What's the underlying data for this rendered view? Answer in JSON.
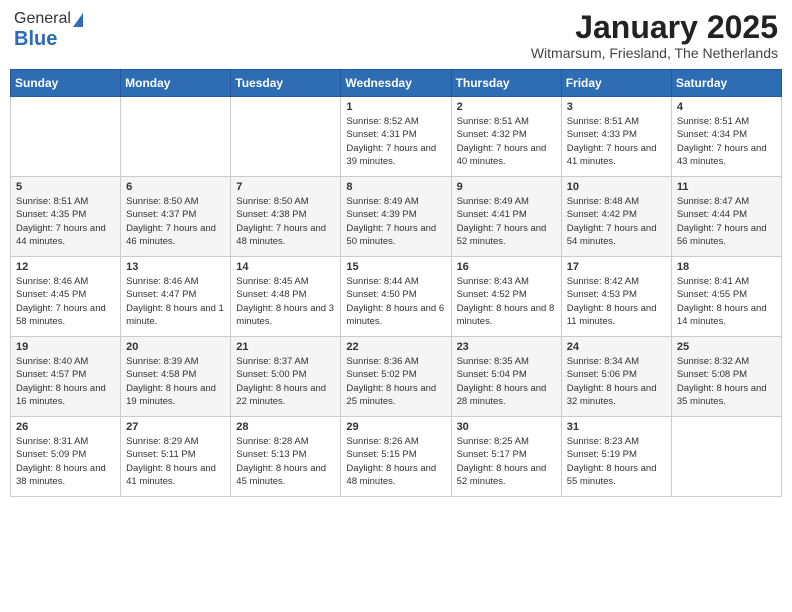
{
  "header": {
    "logo_general": "General",
    "logo_blue": "Blue",
    "month": "January 2025",
    "location": "Witmarsum, Friesland, The Netherlands"
  },
  "weekdays": [
    "Sunday",
    "Monday",
    "Tuesday",
    "Wednesday",
    "Thursday",
    "Friday",
    "Saturday"
  ],
  "weeks": [
    [
      {
        "day": "",
        "sunrise": "",
        "sunset": "",
        "daylight": ""
      },
      {
        "day": "",
        "sunrise": "",
        "sunset": "",
        "daylight": ""
      },
      {
        "day": "",
        "sunrise": "",
        "sunset": "",
        "daylight": ""
      },
      {
        "day": "1",
        "sunrise": "Sunrise: 8:52 AM",
        "sunset": "Sunset: 4:31 PM",
        "daylight": "Daylight: 7 hours and 39 minutes."
      },
      {
        "day": "2",
        "sunrise": "Sunrise: 8:51 AM",
        "sunset": "Sunset: 4:32 PM",
        "daylight": "Daylight: 7 hours and 40 minutes."
      },
      {
        "day": "3",
        "sunrise": "Sunrise: 8:51 AM",
        "sunset": "Sunset: 4:33 PM",
        "daylight": "Daylight: 7 hours and 41 minutes."
      },
      {
        "day": "4",
        "sunrise": "Sunrise: 8:51 AM",
        "sunset": "Sunset: 4:34 PM",
        "daylight": "Daylight: 7 hours and 43 minutes."
      }
    ],
    [
      {
        "day": "5",
        "sunrise": "Sunrise: 8:51 AM",
        "sunset": "Sunset: 4:35 PM",
        "daylight": "Daylight: 7 hours and 44 minutes."
      },
      {
        "day": "6",
        "sunrise": "Sunrise: 8:50 AM",
        "sunset": "Sunset: 4:37 PM",
        "daylight": "Daylight: 7 hours and 46 minutes."
      },
      {
        "day": "7",
        "sunrise": "Sunrise: 8:50 AM",
        "sunset": "Sunset: 4:38 PM",
        "daylight": "Daylight: 7 hours and 48 minutes."
      },
      {
        "day": "8",
        "sunrise": "Sunrise: 8:49 AM",
        "sunset": "Sunset: 4:39 PM",
        "daylight": "Daylight: 7 hours and 50 minutes."
      },
      {
        "day": "9",
        "sunrise": "Sunrise: 8:49 AM",
        "sunset": "Sunset: 4:41 PM",
        "daylight": "Daylight: 7 hours and 52 minutes."
      },
      {
        "day": "10",
        "sunrise": "Sunrise: 8:48 AM",
        "sunset": "Sunset: 4:42 PM",
        "daylight": "Daylight: 7 hours and 54 minutes."
      },
      {
        "day": "11",
        "sunrise": "Sunrise: 8:47 AM",
        "sunset": "Sunset: 4:44 PM",
        "daylight": "Daylight: 7 hours and 56 minutes."
      }
    ],
    [
      {
        "day": "12",
        "sunrise": "Sunrise: 8:46 AM",
        "sunset": "Sunset: 4:45 PM",
        "daylight": "Daylight: 7 hours and 58 minutes."
      },
      {
        "day": "13",
        "sunrise": "Sunrise: 8:46 AM",
        "sunset": "Sunset: 4:47 PM",
        "daylight": "Daylight: 8 hours and 1 minute."
      },
      {
        "day": "14",
        "sunrise": "Sunrise: 8:45 AM",
        "sunset": "Sunset: 4:48 PM",
        "daylight": "Daylight: 8 hours and 3 minutes."
      },
      {
        "day": "15",
        "sunrise": "Sunrise: 8:44 AM",
        "sunset": "Sunset: 4:50 PM",
        "daylight": "Daylight: 8 hours and 6 minutes."
      },
      {
        "day": "16",
        "sunrise": "Sunrise: 8:43 AM",
        "sunset": "Sunset: 4:52 PM",
        "daylight": "Daylight: 8 hours and 8 minutes."
      },
      {
        "day": "17",
        "sunrise": "Sunrise: 8:42 AM",
        "sunset": "Sunset: 4:53 PM",
        "daylight": "Daylight: 8 hours and 11 minutes."
      },
      {
        "day": "18",
        "sunrise": "Sunrise: 8:41 AM",
        "sunset": "Sunset: 4:55 PM",
        "daylight": "Daylight: 8 hours and 14 minutes."
      }
    ],
    [
      {
        "day": "19",
        "sunrise": "Sunrise: 8:40 AM",
        "sunset": "Sunset: 4:57 PM",
        "daylight": "Daylight: 8 hours and 16 minutes."
      },
      {
        "day": "20",
        "sunrise": "Sunrise: 8:39 AM",
        "sunset": "Sunset: 4:58 PM",
        "daylight": "Daylight: 8 hours and 19 minutes."
      },
      {
        "day": "21",
        "sunrise": "Sunrise: 8:37 AM",
        "sunset": "Sunset: 5:00 PM",
        "daylight": "Daylight: 8 hours and 22 minutes."
      },
      {
        "day": "22",
        "sunrise": "Sunrise: 8:36 AM",
        "sunset": "Sunset: 5:02 PM",
        "daylight": "Daylight: 8 hours and 25 minutes."
      },
      {
        "day": "23",
        "sunrise": "Sunrise: 8:35 AM",
        "sunset": "Sunset: 5:04 PM",
        "daylight": "Daylight: 8 hours and 28 minutes."
      },
      {
        "day": "24",
        "sunrise": "Sunrise: 8:34 AM",
        "sunset": "Sunset: 5:06 PM",
        "daylight": "Daylight: 8 hours and 32 minutes."
      },
      {
        "day": "25",
        "sunrise": "Sunrise: 8:32 AM",
        "sunset": "Sunset: 5:08 PM",
        "daylight": "Daylight: 8 hours and 35 minutes."
      }
    ],
    [
      {
        "day": "26",
        "sunrise": "Sunrise: 8:31 AM",
        "sunset": "Sunset: 5:09 PM",
        "daylight": "Daylight: 8 hours and 38 minutes."
      },
      {
        "day": "27",
        "sunrise": "Sunrise: 8:29 AM",
        "sunset": "Sunset: 5:11 PM",
        "daylight": "Daylight: 8 hours and 41 minutes."
      },
      {
        "day": "28",
        "sunrise": "Sunrise: 8:28 AM",
        "sunset": "Sunset: 5:13 PM",
        "daylight": "Daylight: 8 hours and 45 minutes."
      },
      {
        "day": "29",
        "sunrise": "Sunrise: 8:26 AM",
        "sunset": "Sunset: 5:15 PM",
        "daylight": "Daylight: 8 hours and 48 minutes."
      },
      {
        "day": "30",
        "sunrise": "Sunrise: 8:25 AM",
        "sunset": "Sunset: 5:17 PM",
        "daylight": "Daylight: 8 hours and 52 minutes."
      },
      {
        "day": "31",
        "sunrise": "Sunrise: 8:23 AM",
        "sunset": "Sunset: 5:19 PM",
        "daylight": "Daylight: 8 hours and 55 minutes."
      },
      {
        "day": "",
        "sunrise": "",
        "sunset": "",
        "daylight": ""
      }
    ]
  ]
}
